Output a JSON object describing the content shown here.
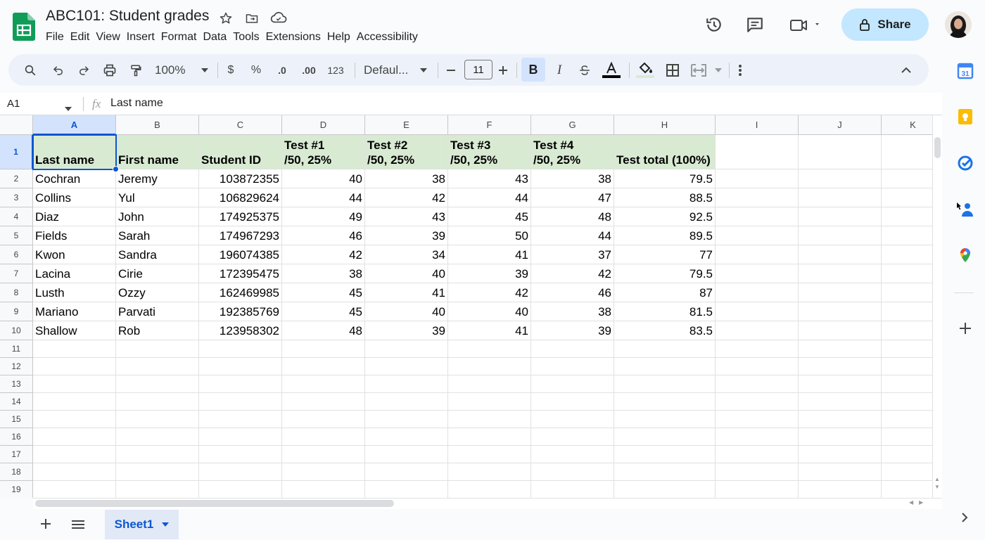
{
  "app": {
    "title": "ABC101: Student grades",
    "menu": [
      "File",
      "Edit",
      "View",
      "Insert",
      "Format",
      "Data",
      "Tools",
      "Extensions",
      "Help",
      "Accessibility"
    ],
    "share_label": "Share"
  },
  "toolbar": {
    "zoom": "100%",
    "currency": "$",
    "percent": "%",
    "dec_decrease": ".0",
    "dec_increase": ".00",
    "format_123": "123",
    "font": "Defaul...",
    "font_size": "11",
    "bold": "B",
    "italic": "I"
  },
  "formula_bar": {
    "cell_ref": "A1",
    "fx": "fx",
    "content": "Last name"
  },
  "sheet": {
    "columns": [
      "A",
      "B",
      "C",
      "D",
      "E",
      "F",
      "G",
      "H",
      "I",
      "J",
      "K"
    ],
    "rows": [
      "1",
      "2",
      "3",
      "4",
      "5",
      "6",
      "7",
      "8",
      "9",
      "10",
      "11",
      "12",
      "13",
      "14",
      "15",
      "16",
      "17",
      "18",
      "19"
    ],
    "header_cells": [
      "Last name",
      "First name",
      "Student ID",
      "Test #1\n/50, 25%",
      "Test #2\n/50, 25%",
      "Test #3\n/50, 25%",
      "Test #4\n/50, 25%",
      "Test total (100%)"
    ],
    "data": [
      [
        "Cochran",
        "Jeremy",
        "103872355",
        "40",
        "38",
        "43",
        "38",
        "79.5"
      ],
      [
        "Collins",
        "Yul",
        "106829624",
        "44",
        "42",
        "44",
        "47",
        "88.5"
      ],
      [
        "Diaz",
        "John",
        "174925375",
        "49",
        "43",
        "45",
        "48",
        "92.5"
      ],
      [
        "Fields",
        "Sarah",
        "174967293",
        "46",
        "39",
        "50",
        "44",
        "89.5"
      ],
      [
        "Kwon",
        "Sandra",
        "196074385",
        "42",
        "34",
        "41",
        "37",
        "77"
      ],
      [
        "Lacina",
        "Cirie",
        "172395475",
        "38",
        "40",
        "39",
        "42",
        "79.5"
      ],
      [
        "Lusth",
        "Ozzy",
        "162469985",
        "45",
        "41",
        "42",
        "46",
        "87"
      ],
      [
        "Mariano",
        "Parvati",
        "192385769",
        "45",
        "40",
        "40",
        "38",
        "81.5"
      ],
      [
        "Shallow",
        "Rob",
        "123958302",
        "48",
        "39",
        "41",
        "39",
        "83.5"
      ]
    ],
    "header_fill": "#d9ead3",
    "selection_color": "#0b57d0"
  },
  "bottom": {
    "sheet_tab": "Sheet1"
  }
}
